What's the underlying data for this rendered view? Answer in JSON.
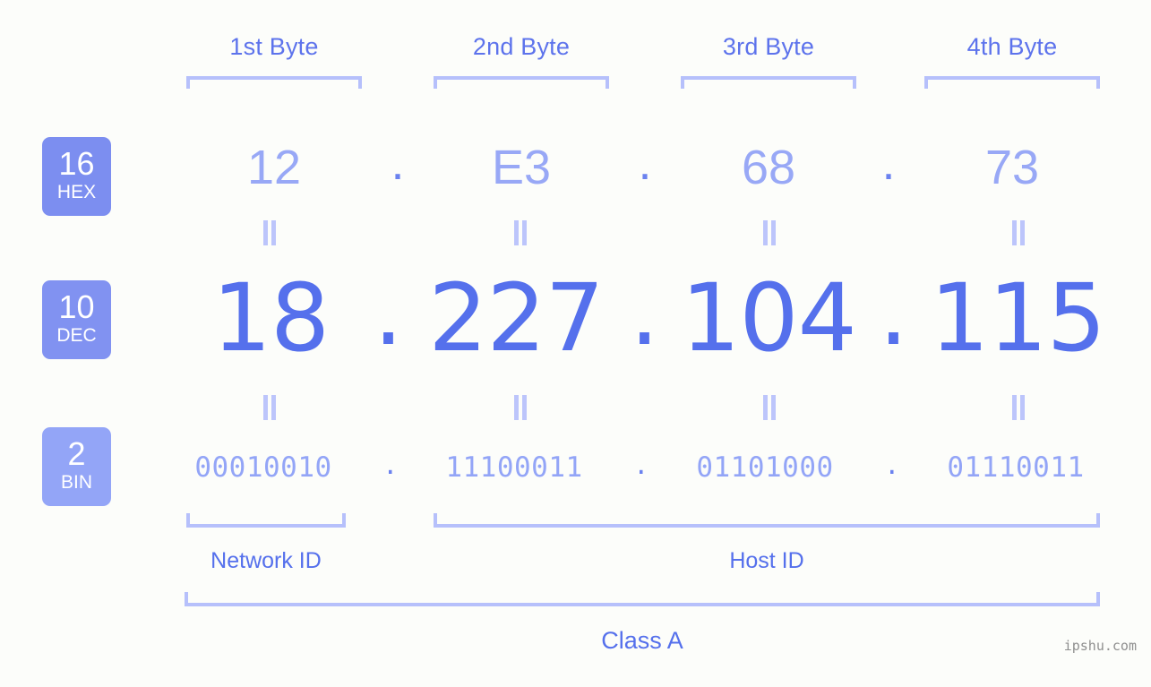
{
  "background_color": "#fcfdfa",
  "accent_colors": {
    "header_blue": "#5d73ec",
    "bracket_blue": "#b6c0fb",
    "hex_blue": "#98a8f6",
    "dec_blue": "#5570ec",
    "bin_blue": "#93a5f7",
    "badge_hex": "#7c8ef0",
    "badge_dec": "#8192f1",
    "badge_bin": "#93a5f7",
    "watermark_gray": "#8f8f8f"
  },
  "byte_headers": [
    {
      "label": "1st Byte"
    },
    {
      "label": "2nd Byte"
    },
    {
      "label": "3rd Byte"
    },
    {
      "label": "4th Byte"
    }
  ],
  "bases": [
    {
      "number": "16",
      "abbr": "HEX"
    },
    {
      "number": "10",
      "abbr": "DEC"
    },
    {
      "number": "2",
      "abbr": "BIN"
    }
  ],
  "rows": {
    "hex": {
      "base_number": "16",
      "base_abbr": "HEX",
      "octets": [
        "12",
        "E3",
        "68",
        "73"
      ],
      "separator": "."
    },
    "dec": {
      "base_number": "10",
      "base_abbr": "DEC",
      "octets": [
        "18",
        "227",
        "104",
        "115"
      ],
      "separator": "."
    },
    "bin": {
      "base_number": "2",
      "base_abbr": "BIN",
      "octets": [
        "00010010",
        "11100011",
        "01101000",
        "01110011"
      ],
      "separator": "."
    }
  },
  "equality_marks": {
    "glyph": "=",
    "count_per_row": 4
  },
  "id_sections": [
    {
      "label": "Network ID"
    },
    {
      "label": "Host ID"
    }
  ],
  "class": {
    "label": "Class A"
  },
  "watermark": {
    "text": "ipshu.com"
  }
}
